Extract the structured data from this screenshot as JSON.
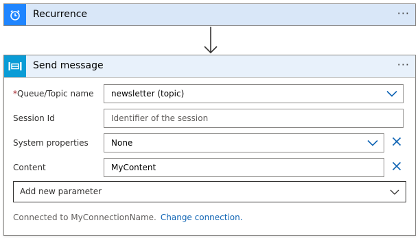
{
  "recurrence": {
    "title": "Recurrence",
    "icon": "alarm-clock-icon",
    "more_label": "···"
  },
  "send_message": {
    "title": "Send message",
    "icon": "service-bus-icon",
    "more_label": "···",
    "fields": {
      "queue_topic": {
        "required_mark": "*",
        "label": "Queue/Topic name",
        "value": "newsletter (topic)"
      },
      "session_id": {
        "label": "Session Id",
        "placeholder": "Identifier of the session"
      },
      "system_properties": {
        "label": "System properties",
        "value": "None"
      },
      "content": {
        "label": "Content",
        "value": "MyContent"
      }
    },
    "add_parameter": {
      "label": "Add new parameter"
    },
    "footer": {
      "connected_text": "Connected to MyConnectionName.",
      "change_link": "Change connection."
    }
  },
  "colors": {
    "recurrence_header_bg": "#d9e7f8",
    "recurrence_icon_bg": "#1f85ff",
    "send_header_bg": "#e8f1fb",
    "send_icon_bg": "#0a9cd6",
    "link": "#0f64b4",
    "chevron": "#0f64b4",
    "required": "#a4262c"
  }
}
